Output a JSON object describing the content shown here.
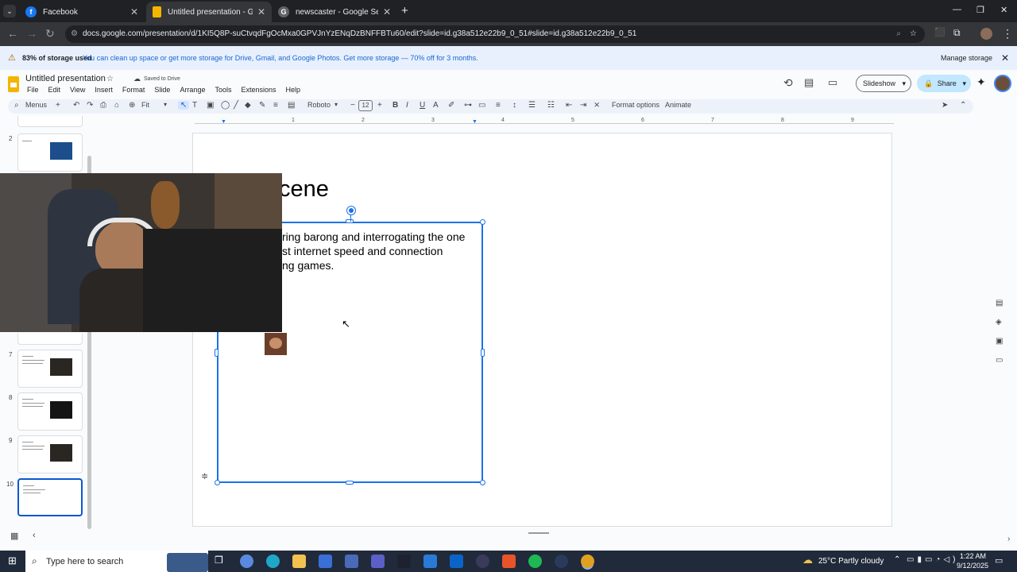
{
  "browser": {
    "tabs": [
      {
        "title": "Facebook",
        "icon_color": "#1877f2",
        "icon": "facebook-icon",
        "glyph": "f"
      },
      {
        "title": "Untitled presentation - Google",
        "icon_color": "#f4b400",
        "icon": "slides-icon",
        "glyph": ""
      },
      {
        "title": "newscaster - Google Search",
        "icon_color": "#5f6368",
        "icon": "google-icon",
        "glyph": "G"
      }
    ],
    "new_tab": "+",
    "url": "docs.google.com/presentation/d/1KI5Q8P-suCtvqdFgOcMxa0GPVJnYzENqDzBNFFBTu60/edit?slide=id.g38a512e22b9_0_51#slide=id.g38a512e22b9_0_51"
  },
  "banner": {
    "title": "83% of storage used",
    "message": "You can clean up space or get more storage for Drive, Gmail, and Google Photos. Get more storage — 70% off for 3 months.",
    "action": "Manage storage"
  },
  "docs": {
    "title": "Untitled presentation",
    "save_status": "Saved to Drive",
    "menu": [
      "File",
      "Edit",
      "View",
      "Insert",
      "Format",
      "Slide",
      "Arrange",
      "Tools",
      "Extensions",
      "Help"
    ],
    "slideshow": "Slideshow",
    "share": "Share"
  },
  "toolbar": {
    "menus": "Menus",
    "zoom": "Fit",
    "font": "Roboto",
    "font_size": "12",
    "format_options": "Format options",
    "animate": "Animate"
  },
  "ruler": [
    "1",
    "2",
    "3",
    "4",
    "5",
    "6",
    "7",
    "8",
    "9"
  ],
  "filmstrip": [
    {
      "num": "2"
    },
    {
      "num": "7"
    },
    {
      "num": "8"
    },
    {
      "num": "9"
    },
    {
      "num": "10"
    }
  ],
  "slide": {
    "title_fragment": "cene",
    "body_lines": [
      "ring barong and interrogating the one",
      "st internet speed and connection",
      "ng games."
    ]
  },
  "taskbar": {
    "search_placeholder": "Type here to search",
    "weather": "25°C  Partly cloudy",
    "time": "1:22 AM",
    "date": "9/12/2025"
  }
}
